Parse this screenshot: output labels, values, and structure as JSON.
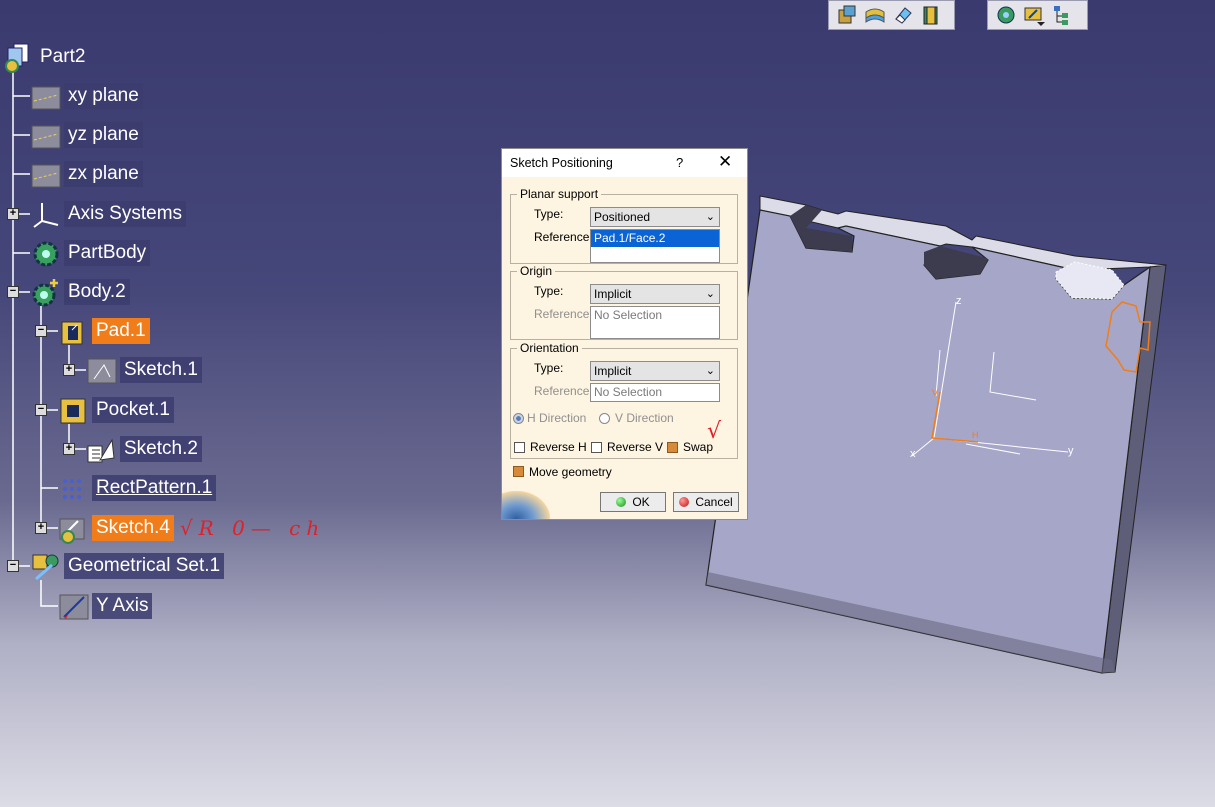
{
  "toolbar_left": {
    "icons": [
      "view-part-icon",
      "surface-icon",
      "eraser-icon",
      "book-icon"
    ]
  },
  "toolbar_right": {
    "icons": [
      "globe-gear-icon",
      "sketch-position-icon",
      "tree-icon"
    ]
  },
  "tree": {
    "root": "Part2",
    "items": [
      {
        "label": "xy plane"
      },
      {
        "label": "yz plane"
      },
      {
        "label": "zx plane"
      },
      {
        "label": "Axis Systems"
      },
      {
        "label": "PartBody"
      },
      {
        "label": "Body.2"
      },
      {
        "label": "Pad.1"
      },
      {
        "label": "Sketch.1"
      },
      {
        "label": "Pocket.1"
      },
      {
        "label": "Sketch.2"
      },
      {
        "label": "RectPattern.1"
      },
      {
        "label": "Sketch.4"
      },
      {
        "label": "Geometrical Set.1"
      },
      {
        "label": "Y Axis"
      }
    ],
    "annotation": "√R 0— ch",
    "highlight_color": "#f07d1a"
  },
  "dialog": {
    "title": "Sketch Positioning",
    "help": "?",
    "close": "✕",
    "planar": {
      "legend": "Planar support",
      "type_label": "Type:",
      "type_value": "Positioned",
      "ref_label": "Reference:",
      "ref_value": "Pad.1/Face.2"
    },
    "origin": {
      "legend": "Origin",
      "type_label": "Type:",
      "type_value": "Implicit",
      "ref_label": "Reference:",
      "ref_value": "No Selection"
    },
    "orientation": {
      "legend": "Orientation",
      "type_label": "Type:",
      "type_value": "Implicit",
      "ref_label": "Reference:",
      "ref_value": "No Selection",
      "h_direction": "H Direction",
      "v_direction": "V Direction",
      "reverse_h": "Reverse H",
      "reverse_v": "Reverse V",
      "swap": "Swap",
      "swap_mark": "√"
    },
    "move_geometry": "Move geometry",
    "ok": "OK",
    "cancel": "Cancel"
  },
  "viewport": {
    "axis_labels": {
      "z": "z",
      "y": "y",
      "x": "x",
      "h": "H",
      "v": "V"
    }
  }
}
